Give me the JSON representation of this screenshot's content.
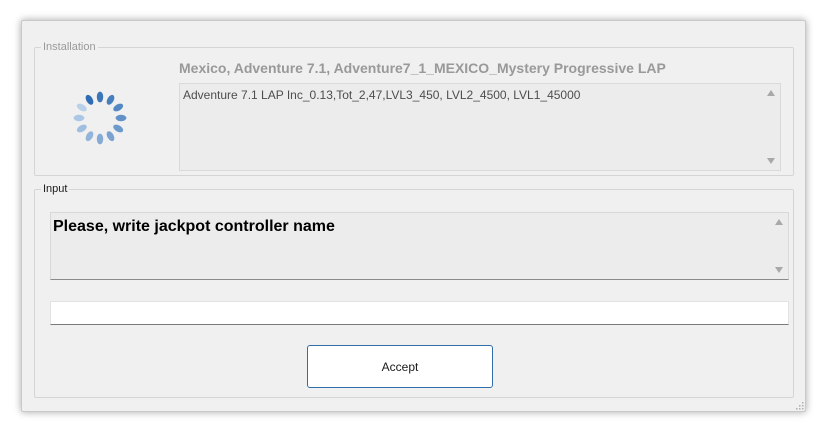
{
  "installation": {
    "group_label": "Installation",
    "title": "Mexico, Adventure 7.1, Adventure7_1_MEXICO_Mystery Progressive LAP",
    "details": "Adventure 7.1 LAP Inc_0.13,Tot_2,47,LVL3_450, LVL2_4500, LVL1_45000",
    "spinner_icon": "loading-spinner-icon"
  },
  "input": {
    "group_label": "Input",
    "prompt": "Please, write jackpot controller name",
    "value": "",
    "accept_label": "Accept"
  },
  "colors": {
    "window_bg": "#f0f0f0",
    "spinner_dark": "#2e6db4",
    "spinner_light": "#b9d0ea",
    "button_border": "#2f6ea8"
  }
}
